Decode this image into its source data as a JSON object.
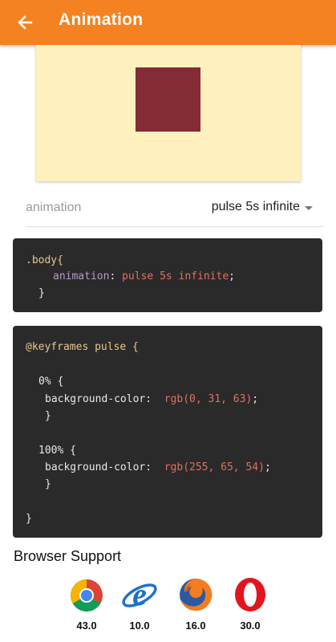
{
  "colors": {
    "accent": "#F58220",
    "preview_bg": "#FFF0BE",
    "preview_box": "#832C36",
    "code_bg": "#2A2A2A"
  },
  "appbar": {
    "title": "Animation",
    "back_icon": "arrow-back-icon"
  },
  "property": {
    "label": "animation",
    "value": "pulse 5s infinite"
  },
  "code1": {
    "selector": ".body{",
    "prop": "animation",
    "colon": ":",
    "value": "pulse 5s infinite",
    "semicolon": ";",
    "close": "}"
  },
  "code2": {
    "keyframes": "@keyframes pulse {",
    "step1": "0% {",
    "step1_prop": "background-color:",
    "step1_val": "rgb(0, 31, 63)",
    "step1_semi": ";",
    "step1_close": "}",
    "step2": "100% {",
    "step2_prop": "background-color:",
    "step2_val": "rgb(255, 65, 54)",
    "step2_semi": ";",
    "step2_close": "}",
    "close": "}"
  },
  "browser_support": {
    "title": "Browser Support",
    "browsers": [
      {
        "icon": "chrome-icon",
        "version": "43.0"
      },
      {
        "icon": "internet-explorer-icon",
        "version": "10.0"
      },
      {
        "icon": "firefox-icon",
        "version": "16.0"
      },
      {
        "icon": "opera-icon",
        "version": "30.0"
      }
    ]
  }
}
